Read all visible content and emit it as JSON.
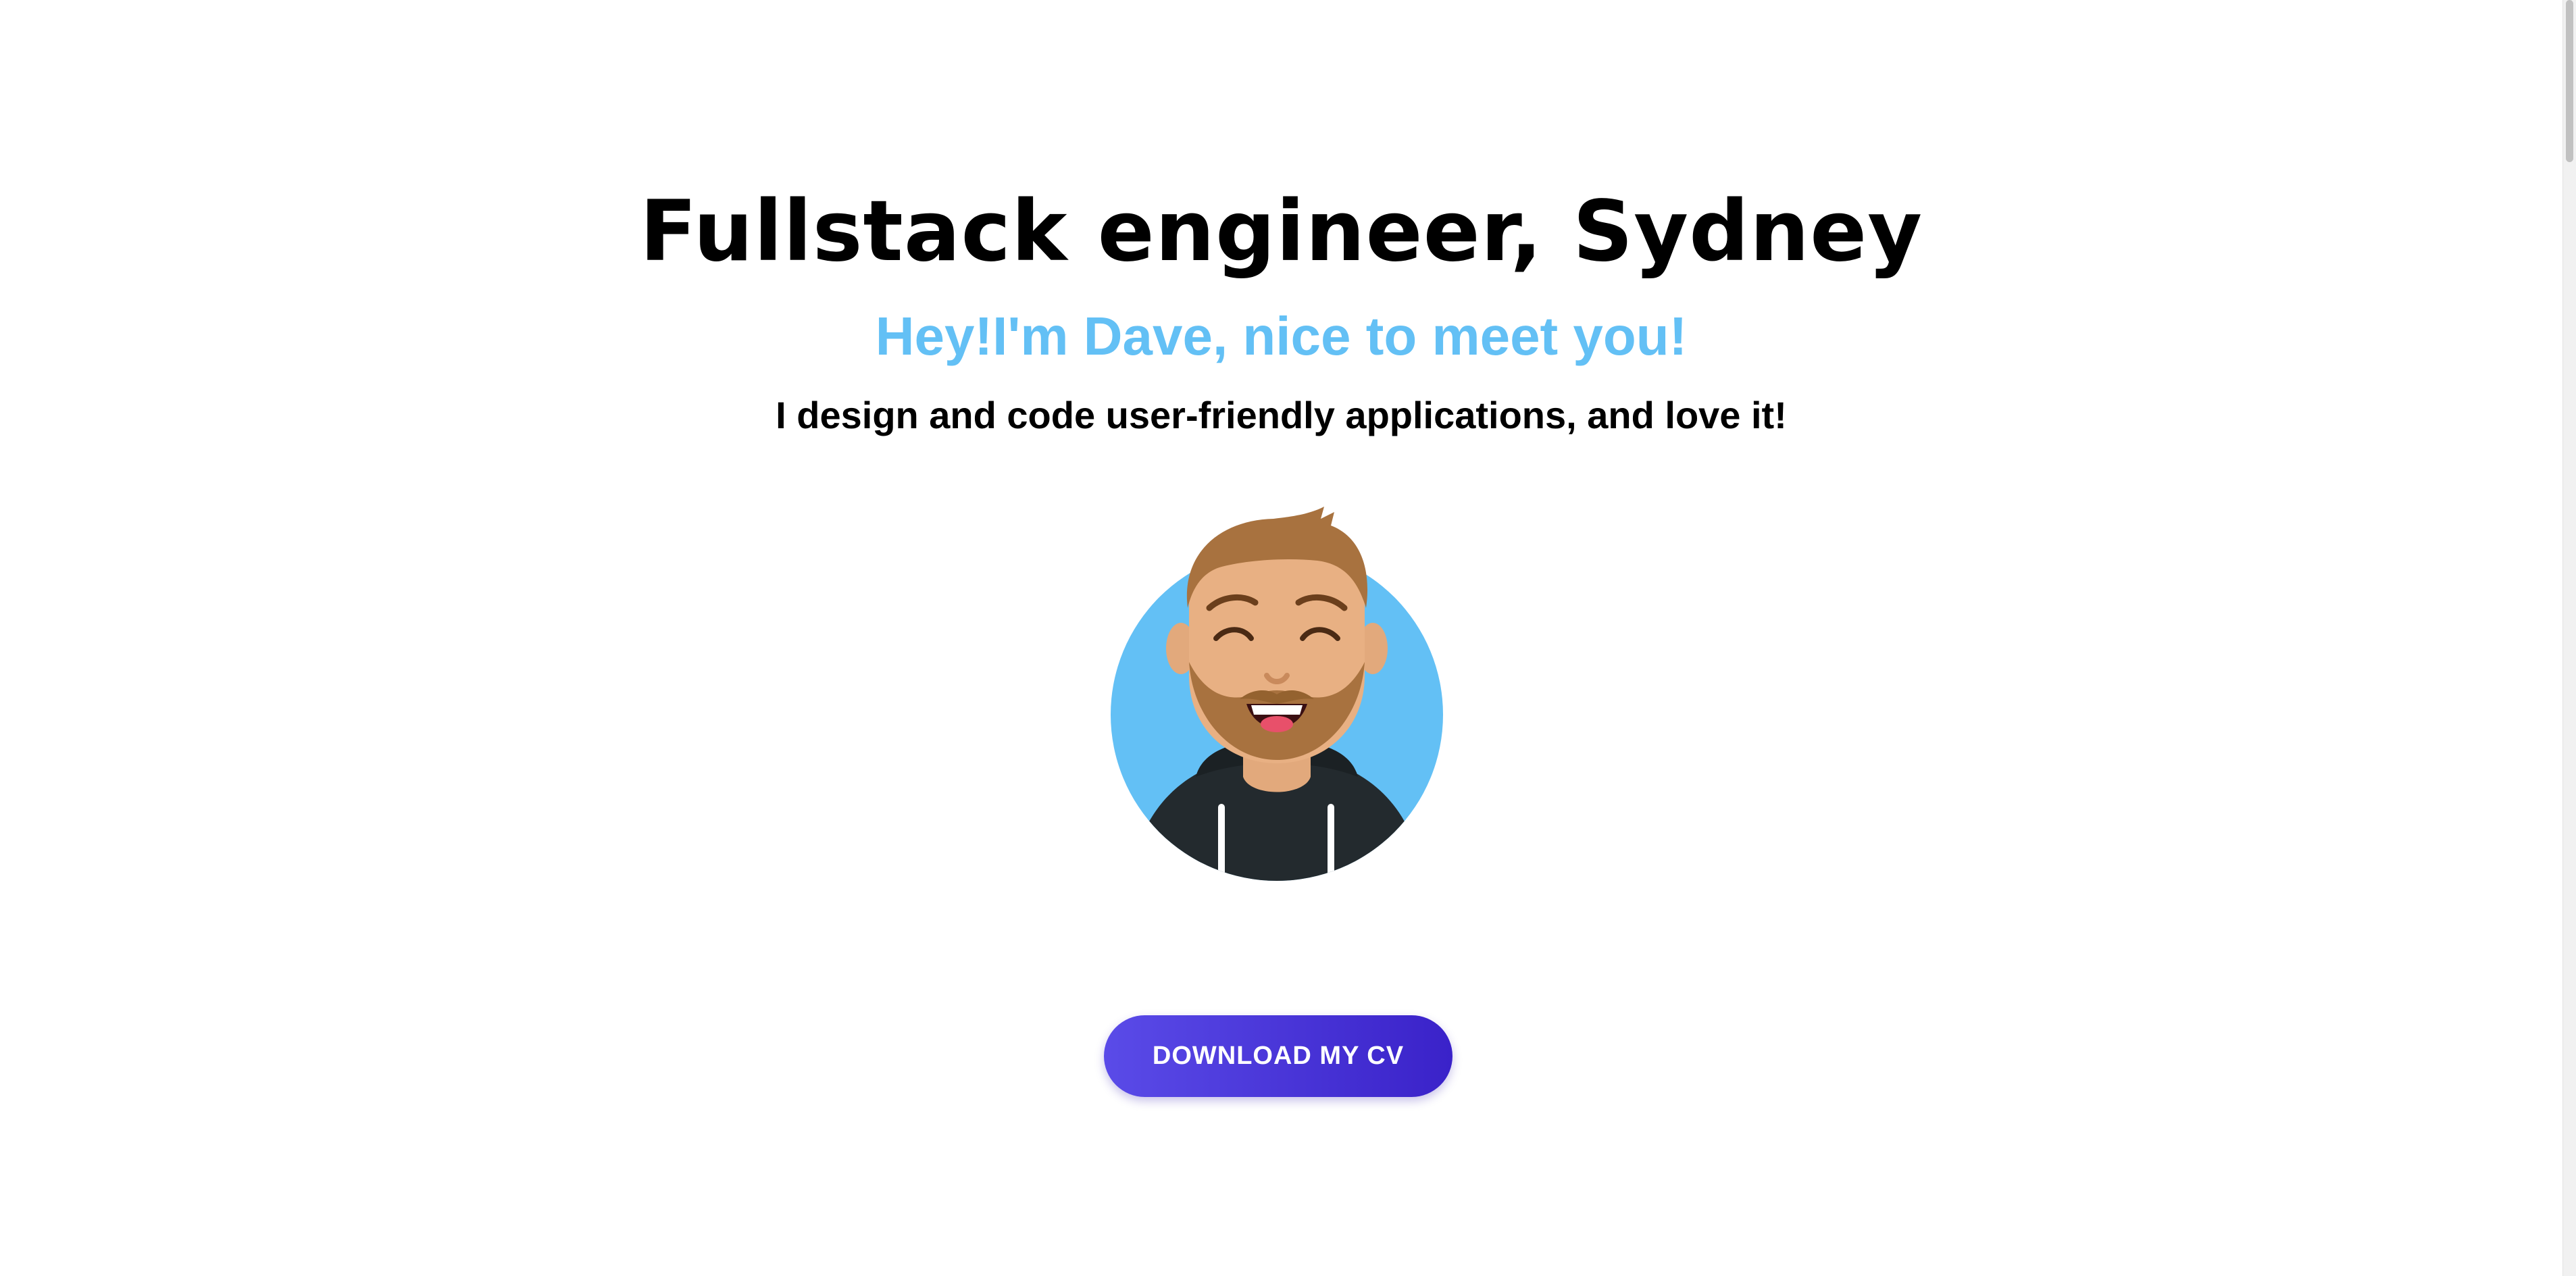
{
  "hero": {
    "headline": "Fullstack engineer, Sydney",
    "greeting": "Hey!I'm Dave, nice to meet you!",
    "tagline": "I design and code user-friendly applications, and love it!"
  },
  "avatar": {
    "icon": "smiling-bearded-man-avatar-icon",
    "background_color": "#63c0f5"
  },
  "cta": {
    "label": "DOWNLOAD MY CV",
    "gradient_start": "#5a4be8",
    "gradient_end": "#3a22c9"
  },
  "colors": {
    "accent": "#63c0f5",
    "text": "#000000",
    "background": "#ffffff"
  }
}
